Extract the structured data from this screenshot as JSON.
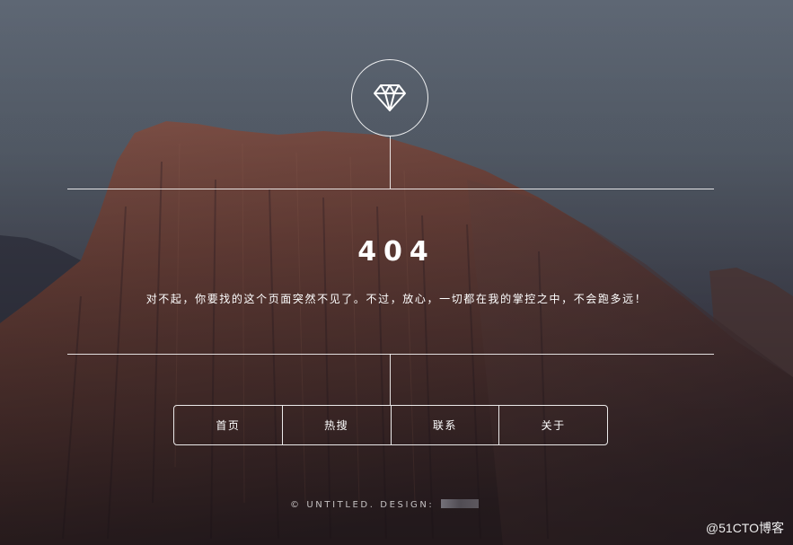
{
  "logo": {
    "icon": "diamond-icon"
  },
  "error": {
    "code": "404",
    "message": "对不起，你要找的这个页面突然不见了。不过，放心，一切都在我的掌控之中，不会跑多远！"
  },
  "nav": {
    "items": [
      {
        "label": "首页"
      },
      {
        "label": "热搜"
      },
      {
        "label": "联系"
      },
      {
        "label": "关于"
      }
    ]
  },
  "footer": {
    "text": "© UNTITLED. DESIGN: "
  },
  "watermark": "@51CTO博客",
  "colors": {
    "sky": "#5b6470",
    "rock": "#7a4e46",
    "line": "#ffffff"
  }
}
